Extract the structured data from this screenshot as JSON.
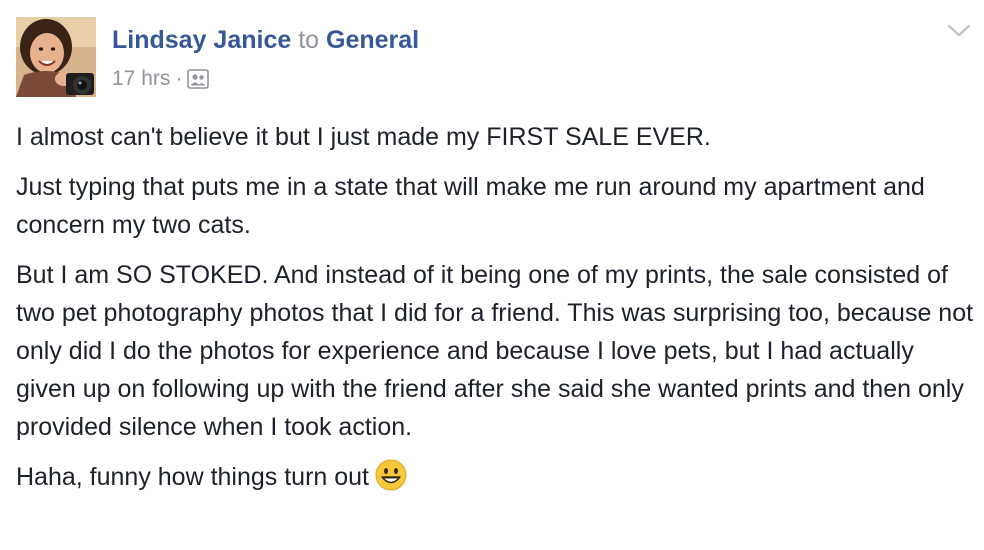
{
  "post": {
    "author": "Lindsay Janice",
    "to_word": "to",
    "group": "General",
    "time": "17 hrs",
    "separator": "·",
    "audience_icon": "group-audience-icon",
    "menu_icon": "chevron-down-icon",
    "paragraphs": [
      "I almost can't believe it but I just made my FIRST SALE EVER.",
      "Just typing that puts me in a state that will make me run around my apartment and concern my two cats.",
      "But I am SO STOKED. And instead of it being one of my prints, the sale consisted of two pet photography photos that I did for a friend. This was surprising too, because not only did I do the photos for experience and because I love pets, but I had actually given up on following up with the friend after she said she wanted prints and then only provided silence when I took action.",
      "Haha, funny how things turn out"
    ],
    "emoji": "grinning-face-emoji"
  },
  "colors": {
    "link": "#365899",
    "secondary_text": "#90949c",
    "body_text": "#1d2129"
  }
}
